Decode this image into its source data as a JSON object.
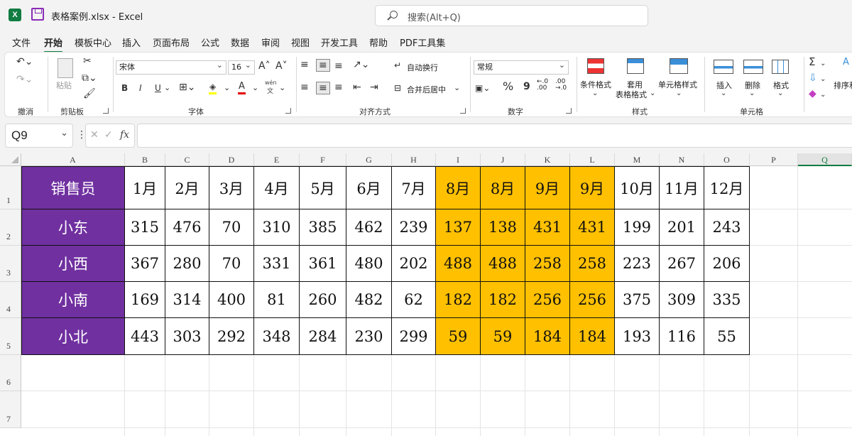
{
  "window": {
    "app_icon_letter": "X",
    "title": "表格案例.xlsx  -  Excel",
    "search_placeholder": "搜索(Alt+Q)"
  },
  "menu": {
    "tabs": [
      "文件",
      "开始",
      "模板中心",
      "插入",
      "页面布局",
      "公式",
      "数据",
      "审阅",
      "视图",
      "开发工具",
      "帮助",
      "PDF工具集"
    ],
    "active": "开始"
  },
  "ribbon": {
    "undo_group": "撤消",
    "clipboard": {
      "paste": "粘贴",
      "label": "剪贴板"
    },
    "font": {
      "name": "宋体",
      "size": "16",
      "grow": "A^",
      "shrink": "Aˇ",
      "bold": "B",
      "italic": "I",
      "underline": "U",
      "font_color": "A",
      "phonetic_top": "wén",
      "phonetic_bottom": "文",
      "label": "字体"
    },
    "alignment": {
      "wrap": "自动换行",
      "merge": "合并后居中",
      "label": "对齐方式"
    },
    "number": {
      "format": "常规",
      "percent": "%",
      "comma": "9",
      "inc_dec": "←.0\n.00",
      "dec_dec": ".00\n→.0",
      "label": "数字"
    },
    "styles": {
      "conditional": "条件格式",
      "table_top": "套用",
      "table_bottom": "表格格式",
      "cell_styles": "单元格样式",
      "label": "样式"
    },
    "cells": {
      "insert": "插入",
      "delete": "删除",
      "format": "格式",
      "label": "单元格"
    },
    "editing": {
      "sigma": "Σ",
      "sort": "排序和"
    }
  },
  "formula_bar": {
    "name_box": "Q9",
    "cancel": "✕",
    "enter": "✓",
    "fx": "fx",
    "formula": ""
  },
  "sheet": {
    "column_headers": [
      "A",
      "B",
      "C",
      "D",
      "E",
      "F",
      "G",
      "H",
      "I",
      "J",
      "K",
      "L",
      "M",
      "N",
      "O",
      "P",
      "Q"
    ],
    "selected_column": "Q",
    "row_headers": [
      "1",
      "2",
      "3",
      "4",
      "5",
      "6",
      "7"
    ],
    "header_row": [
      "销售员",
      "1月",
      "2月",
      "3月",
      "4月",
      "5月",
      "6月",
      "7月",
      "8月",
      "8月",
      "9月",
      "9月",
      "10月",
      "11月",
      "12月"
    ],
    "rows": [
      [
        "小东",
        "315",
        "476",
        "70",
        "310",
        "385",
        "462",
        "239",
        "137",
        "138",
        "431",
        "431",
        "199",
        "201",
        "243"
      ],
      [
        "小西",
        "367",
        "280",
        "70",
        "331",
        "361",
        "480",
        "202",
        "488",
        "488",
        "258",
        "258",
        "223",
        "267",
        "206"
      ],
      [
        "小南",
        "169",
        "314",
        "400",
        "81",
        "260",
        "482",
        "62",
        "182",
        "182",
        "256",
        "256",
        "375",
        "309",
        "335"
      ],
      [
        "小北",
        "443",
        "303",
        "292",
        "348",
        "284",
        "230",
        "299",
        "59",
        "59",
        "184",
        "184",
        "193",
        "116",
        "55"
      ]
    ],
    "colors": {
      "name_fill": "#7030a0",
      "highlight_fill": "#ffc000",
      "accent": "#107c41"
    }
  }
}
